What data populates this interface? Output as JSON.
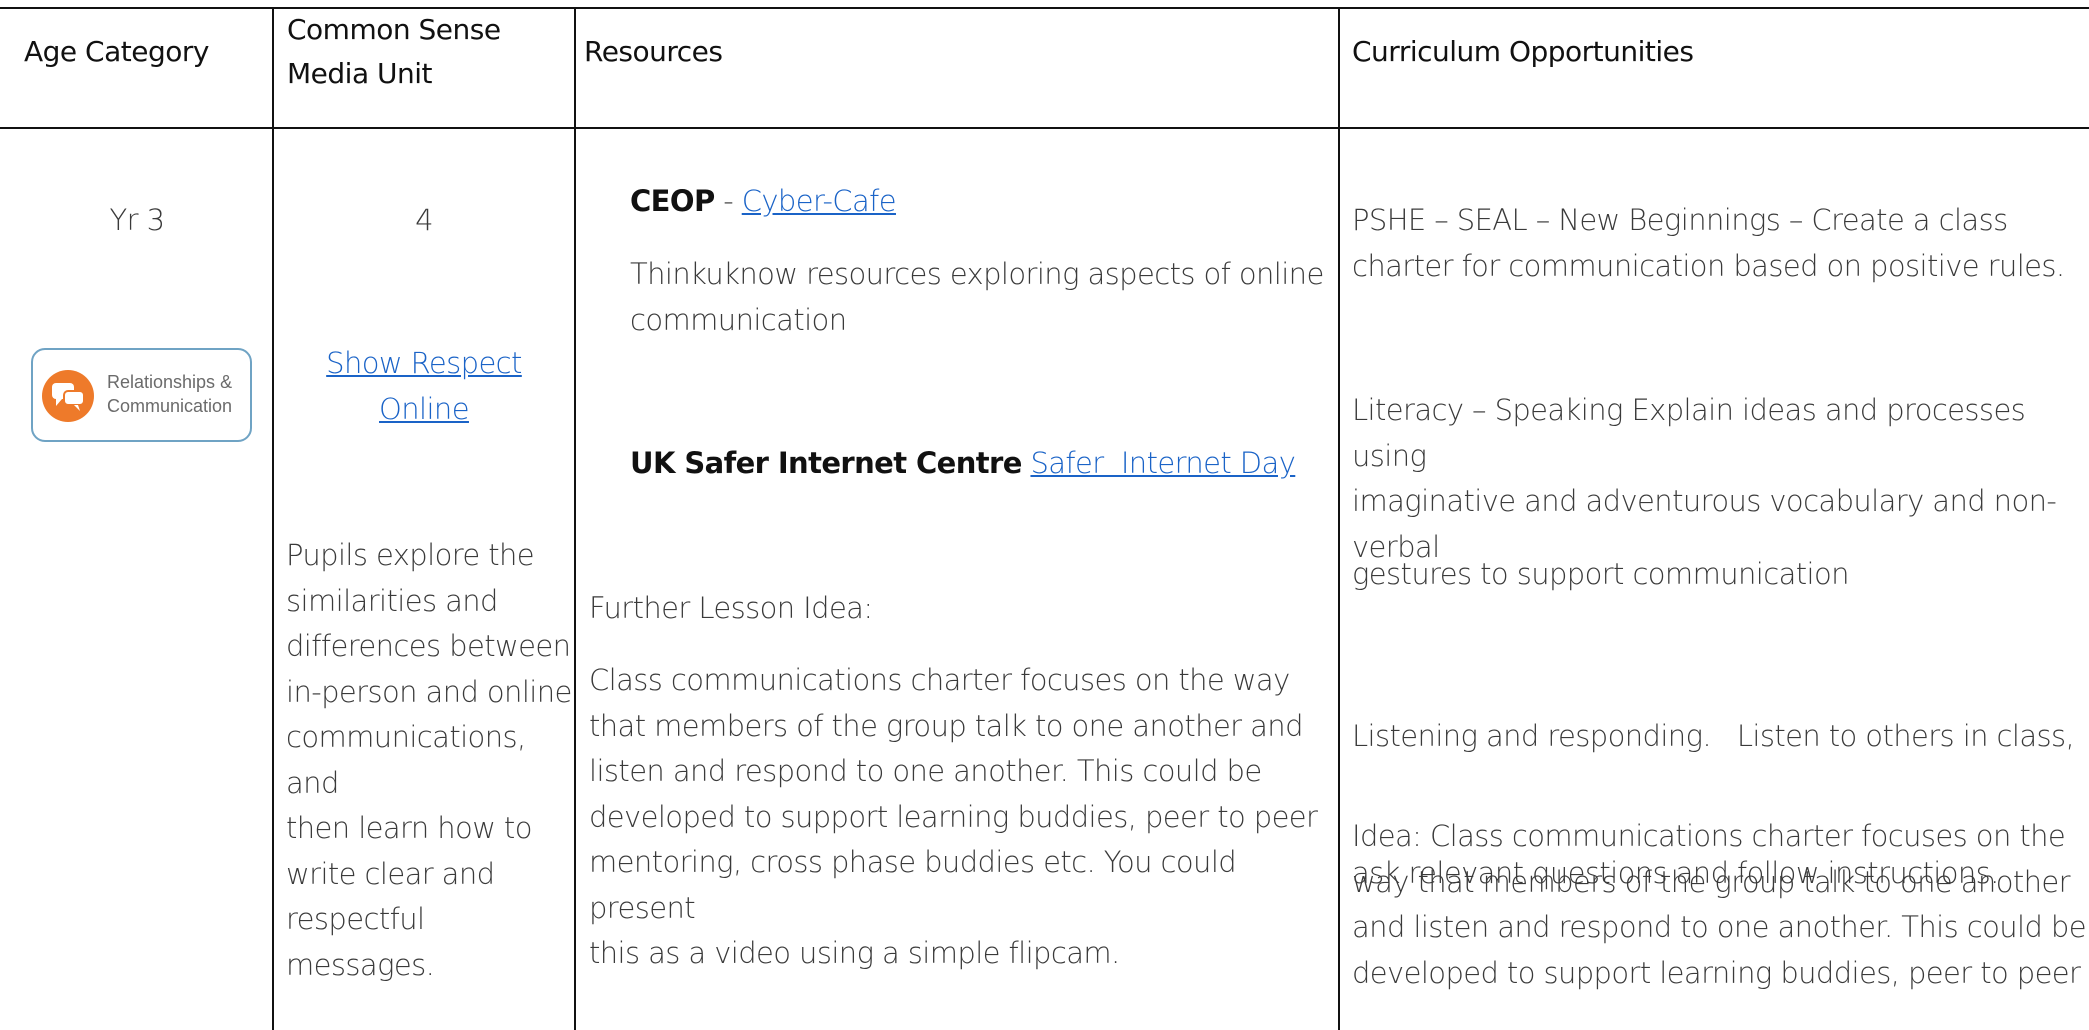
{
  "header": {
    "age_category": "Age Category",
    "unit_line1": "Common Sense",
    "unit_line2": "Media Unit",
    "resources": "Resources",
    "curriculum": "Curriculum Opportunities"
  },
  "row": {
    "age": "Yr 3",
    "badge": {
      "icon": "speech-bubbles-icon",
      "label_line1": "Relationships &",
      "label_line2": "Communication",
      "color": "#ee7a2a"
    },
    "unit_number": "4",
    "unit_link_line1": "Show Respect",
    "unit_link_line2": "Online",
    "unit_description": [
      "Pupils explore the",
      "similarities and",
      "differences between",
      "in-person and online",
      "communications, and",
      "then learn how to",
      "write clear and",
      "respectful",
      "messages."
    ],
    "resources": {
      "ceop_name": "CEOP",
      "ceop_sep": " - ",
      "ceop_link": "Cyber-Cafe",
      "thinkuknow_lines": [
        "Thinkuknow resources exploring aspects of online",
        "communication"
      ],
      "ukcis_name": "UK Safer Internet Centre",
      "ukcis_link": "Safer  Internet Day",
      "further_title": "Further Lesson Idea:",
      "further_lines": [
        "Class communications charter focuses on the way",
        "that members of the group talk to one another and",
        "listen and respond to one another.  This could be",
        "developed to support learning buddies, peer to peer",
        "mentoring, cross phase buddies etc.  You could present",
        "this as a video using a simple flipcam."
      ]
    },
    "curriculum": {
      "pshe_lines": [
        "PSHE – SEAL – New Beginnings – Create a class",
        "charter for communication based on positive rules."
      ],
      "literacy_lines": [
        "Literacy – Speaking Explain ideas and processes using",
        "imaginative and adventurous vocabulary and non-",
        "verbal"
      ],
      "gestures": "gestures to support communication",
      "listening_lines": [
        "Listening and responding.   Listen to others in class,",
        "ask relevant questions and follow instructions."
      ],
      "idea_lines": [
        "Idea: Class communications charter focuses on the",
        "way that members of the group talk to one another",
        "and listen and respond to one another.  This could be",
        "developed to support learning buddies, peer to peer"
      ]
    }
  },
  "colors": {
    "link": "#1a63c7",
    "grid": "#111111",
    "badge_border": "#6fa3c4"
  }
}
